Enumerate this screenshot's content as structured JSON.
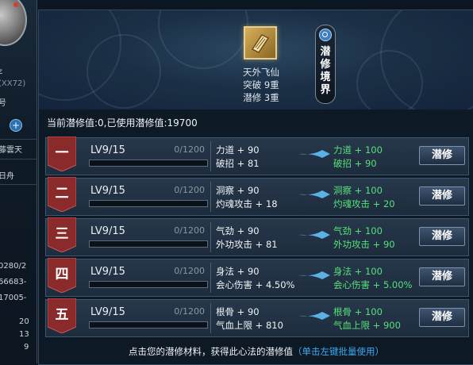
{
  "left_panel": {
    "lines": [
      "ε",
      "(XX72)",
      "号",
      "藤雲天",
      "日舟",
      "0280/2",
      "66683-",
      "17005-",
      "20",
      "13",
      "9"
    ]
  },
  "header": {
    "item_name": "天外飞仙",
    "breakthrough": "突破 9重",
    "cultivation": "潜修 3重",
    "side_button": "潜修境界",
    "side_button_icon": "magnifier-icon"
  },
  "summary": "当前潜修值:0,已使用潜修值:19700",
  "rows": [
    {
      "numeral": "一",
      "level": "LV9/15",
      "progress": "0/1200",
      "progress_fraction": 0,
      "cur1": "力道 + 90",
      "cur2": "破招 + 81",
      "next1": "力道 + 100",
      "next2": "破招 + 90",
      "button": "潜修"
    },
    {
      "numeral": "二",
      "level": "LV9/15",
      "progress": "0/1200",
      "progress_fraction": 0,
      "cur1": "洞察 + 90",
      "cur2": "灼魂攻击 + 18",
      "next1": "洞察 + 100",
      "next2": "灼魂攻击 + 20",
      "button": "潜修"
    },
    {
      "numeral": "三",
      "level": "LV9/15",
      "progress": "0/1200",
      "progress_fraction": 0,
      "cur1": "气劲 + 90",
      "cur2": "外功攻击 + 81",
      "next1": "气劲 + 100",
      "next2": "外功攻击 + 90",
      "button": "潜修"
    },
    {
      "numeral": "四",
      "level": "LV9/15",
      "progress": "0/1200",
      "progress_fraction": 0,
      "cur1": "身法 + 90",
      "cur2": "会心伤害 + 4.50%",
      "next1": "身法 + 100",
      "next2": "会心伤害 + 5.00%",
      "button": "潜修"
    },
    {
      "numeral": "五",
      "level": "LV9/15",
      "progress": "0/1200",
      "progress_fraction": 0,
      "cur1": "根骨 + 90",
      "cur2": "气血上限 + 810",
      "next1": "根骨 + 100",
      "next2": "气血上限 + 900",
      "button": "潜修"
    }
  ],
  "footer": {
    "text": "点击您的潜修材料，获得此心法的潜修值",
    "hint": "（单击左键批量使用）"
  },
  "colors": {
    "banner": "#8a2a2a",
    "next_stat": "#57e07a",
    "hint": "#3fa9f0",
    "progress_fill": "#3fa0e6"
  }
}
